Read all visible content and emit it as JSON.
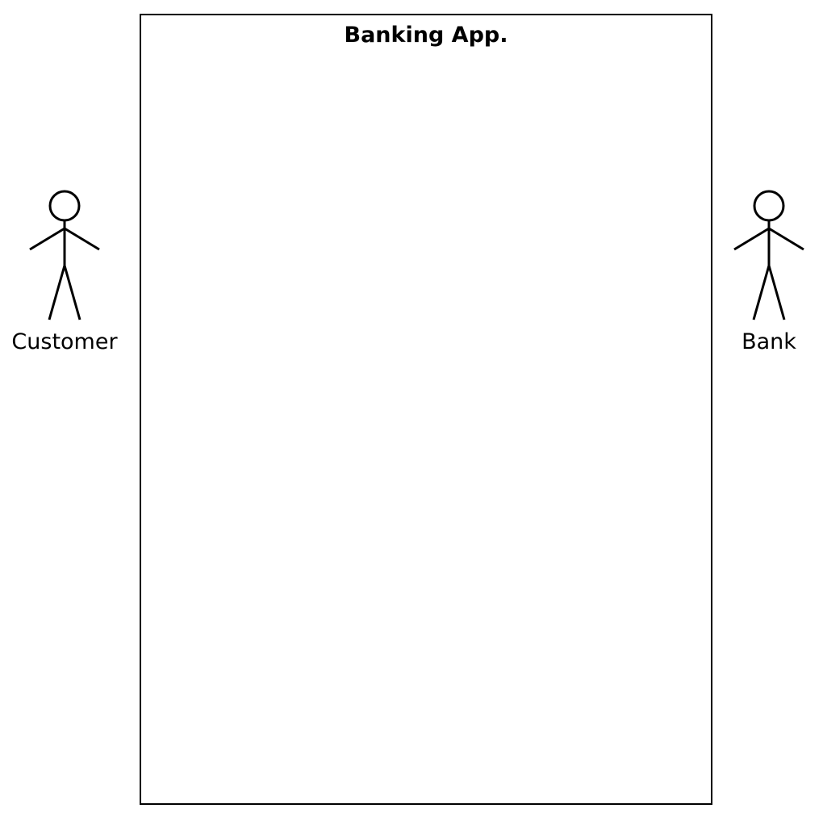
{
  "diagram": {
    "system": {
      "title": "Banking App."
    },
    "actors": [
      {
        "id": "customer",
        "label": "Customer"
      },
      {
        "id": "bank",
        "label": "Bank"
      }
    ],
    "colors": {
      "stroke": "#000000",
      "background": "#ffffff"
    }
  }
}
